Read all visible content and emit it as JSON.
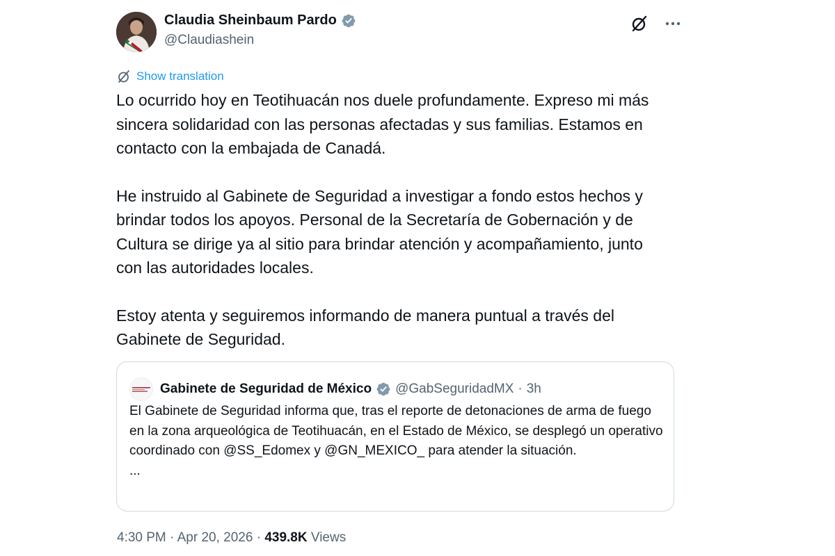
{
  "author": {
    "name": "Claudia Sheinbaum Pardo",
    "handle": "@Claudiashein",
    "verified": true
  },
  "translate_label": "Show translation",
  "tweet": {
    "paragraphs": [
      "Lo ocurrido hoy en Teotihuacán nos duele profundamente. Expreso mi más sincera solidaridad con las personas afectadas y sus familias. Estamos en contacto con la embajada de Canadá.",
      "He instruido al Gabinete de Seguridad a investigar a fondo estos hechos y brindar todos los apoyos. Personal de la Secretaría de Gobernación y de Cultura se dirige ya al sitio para brindar atención y acompañamiento, junto con las autoridades locales.",
      "Estoy atenta y seguiremos informando de manera puntual a través del Gabinete de Seguridad."
    ]
  },
  "quote": {
    "name": "Gabinete de Seguridad de México",
    "handle": "@GabSeguridadMX",
    "separator": "·",
    "time": "3h",
    "text": "El Gabinete de Seguridad informa que, tras el reporte de detonaciones de arma de fuego en la zona arqueológica de Teotihuacán, en el Estado de México, se desplegó un operativo coordinado con @SS_Edomex y @GN_MEXICO_ para atender la situación.",
    "ellipsis": "..."
  },
  "meta": {
    "time": "4:30 PM",
    "separator": "·",
    "date": "Apr 20, 2026",
    "views_count": "439.8K",
    "views_label": "Views"
  },
  "icons": {
    "grok": "slashed-circle-icon",
    "more": "more-dots-icon",
    "verified": "verified-badge-icon",
    "translate": "translate-icon"
  },
  "colors": {
    "accent": "#1d9bf0",
    "text": "#0f1419",
    "secondary": "#536471",
    "border": "#cfd9de",
    "verified": "#829aab"
  }
}
